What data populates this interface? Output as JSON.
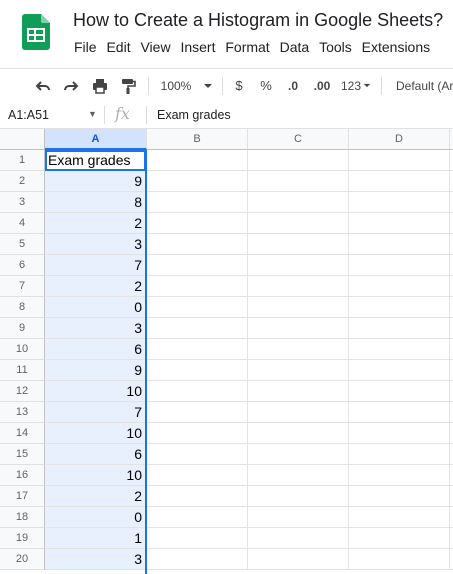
{
  "app": {
    "doc_title": "How to Create a Histogram in Google Sheets?",
    "menu": [
      "File",
      "Edit",
      "View",
      "Insert",
      "Format",
      "Data",
      "Tools",
      "Extensions"
    ]
  },
  "toolbar": {
    "zoom": "100%",
    "currency": "$",
    "percent": "%",
    "decrease_decimal": ".0",
    "increase_decimal": ".00",
    "more_formats": "123",
    "font": "Default (Ar"
  },
  "formula_bar": {
    "name_box": "A1:A51",
    "fx": "fx",
    "value": "Exam grades"
  },
  "grid": {
    "columns": [
      "A",
      "B",
      "C",
      "D"
    ],
    "rows": [
      "1",
      "2",
      "3",
      "4",
      "5",
      "6",
      "7",
      "8",
      "9",
      "10",
      "11",
      "12",
      "13",
      "14",
      "15",
      "16",
      "17",
      "18",
      "19",
      "20"
    ],
    "column_a": [
      "Exam grades",
      "9",
      "8",
      "2",
      "3",
      "7",
      "2",
      "0",
      "3",
      "6",
      "9",
      "10",
      "7",
      "10",
      "6",
      "10",
      "2",
      "0",
      "1",
      "3"
    ]
  },
  "colors": {
    "accent": "#1a73e8",
    "selection_fill": "#e8f0fe",
    "logo_green": "#0f9d58"
  }
}
